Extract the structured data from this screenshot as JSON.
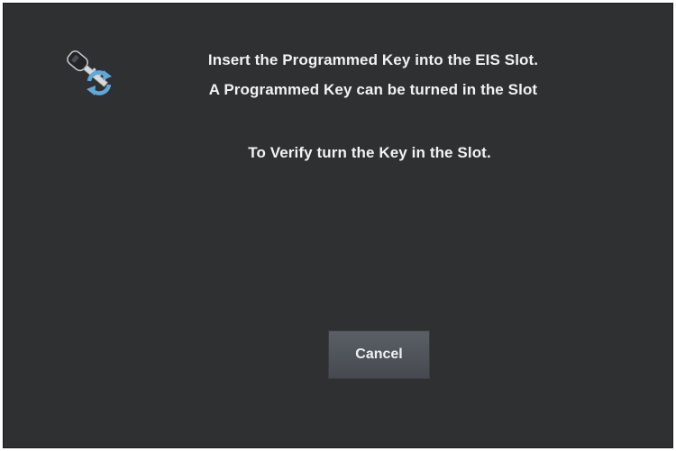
{
  "dialog": {
    "line1": "Insert the Programmed Key into the EIS Slot.",
    "line2": "A Programmed Key can be turned in the Slot",
    "line3": "To Verify turn the Key in the Slot.",
    "icon": "key-sync-icon"
  },
  "buttons": {
    "cancel_label": "Cancel"
  },
  "colors": {
    "background": "#2e3032",
    "text": "#f2f2f2",
    "button": "#50555b",
    "icon_accent": "#5fa8d8"
  }
}
